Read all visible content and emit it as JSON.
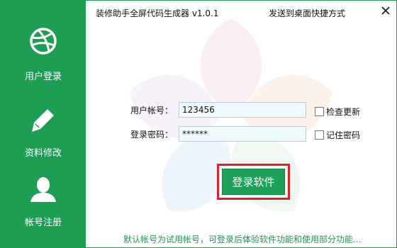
{
  "window": {
    "title": "装修助手全屏代码生成器 v1.0.1",
    "shortcut_link": "发送到桌面快捷方式",
    "close_glyph": "✕"
  },
  "sidebar": {
    "items": [
      {
        "label": "用户登录",
        "icon": "dribbble-ball-icon"
      },
      {
        "label": "资料修改",
        "icon": "pencil-icon"
      },
      {
        "label": "帐号注册",
        "icon": "user-icon"
      }
    ]
  },
  "form": {
    "username_label": "用户帐号：",
    "username_value": "123456",
    "password_label": "登录密码：",
    "password_value": "******",
    "check_update_label": "检查更新",
    "remember_password_label": "记住密码",
    "login_button": "登录软件"
  },
  "footer": {
    "note": "默认帐号为试用帐号，可登录后体验软件功能和使用部分功能..."
  },
  "colors": {
    "sidebar": "#1e9e54",
    "button": "#1ea159",
    "highlight": "#d9232a",
    "input_bg": "#eefafc"
  }
}
